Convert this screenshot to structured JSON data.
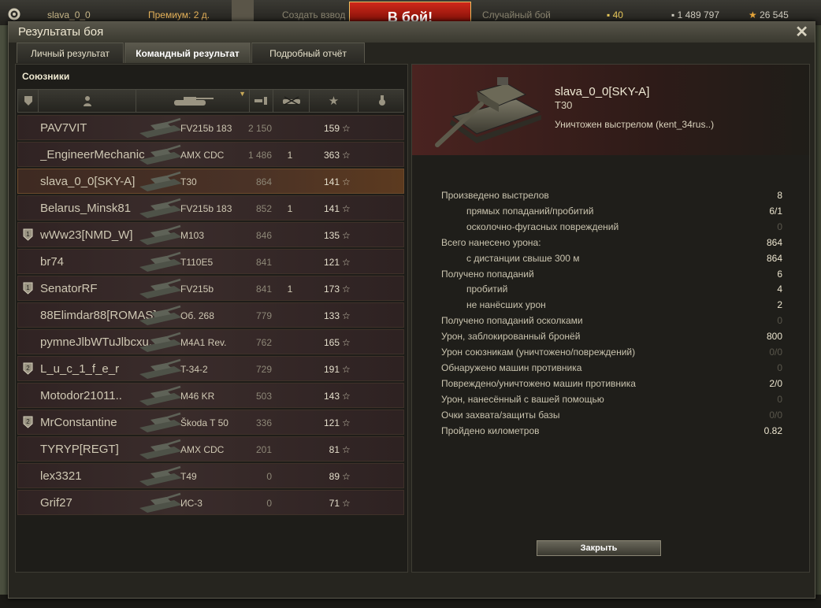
{
  "topbar": {
    "nick": "slava_0_0",
    "premium": "Премиум: 2 д.",
    "create_squad": "Создать взвод",
    "battle_button": "В бой!",
    "battle_mode": "Случайный бой",
    "gold": "40",
    "credits": "1 489 797",
    "free_xp": "26 545"
  },
  "window": {
    "title": "Результаты боя",
    "tabs": [
      "Личный результат",
      "Командный результат",
      "Подробный отчёт"
    ],
    "active_tab": 1
  },
  "team": {
    "heading": "Союзники",
    "rows": [
      {
        "platoon": "",
        "name": "PAV7VIT",
        "tank": "FV215b 183",
        "damage": "2 150",
        "kills": "",
        "xp": "159"
      },
      {
        "platoon": "",
        "name": "_EngineerMechanic_",
        "tank": "AMX CDC",
        "damage": "1 486",
        "kills": "1",
        "xp": "363"
      },
      {
        "platoon": "",
        "name": "slava_0_0[SKY-A]",
        "tank": "T30",
        "damage": "864",
        "kills": "",
        "xp": "141"
      },
      {
        "platoon": "",
        "name": "Belarus_Minsk81",
        "tank": "FV215b 183",
        "damage": "852",
        "kills": "1",
        "xp": "141"
      },
      {
        "platoon": "1",
        "name": "wWw23[NMD_W]",
        "tank": "M103",
        "damage": "846",
        "kills": "",
        "xp": "135"
      },
      {
        "platoon": "",
        "name": "br74",
        "tank": "T110E5",
        "damage": "841",
        "kills": "",
        "xp": "121"
      },
      {
        "platoon": "1",
        "name": "SenatorRF",
        "tank": "FV215b",
        "damage": "841",
        "kills": "1",
        "xp": "173"
      },
      {
        "platoon": "",
        "name": "88Elimdar88[ROMAS]",
        "tank": "Об. 268",
        "damage": "779",
        "kills": "",
        "xp": "133"
      },
      {
        "platoon": "",
        "name": "pymneJlbWTuJlbcxu..",
        "tank": "M4A1 Rev.",
        "damage": "762",
        "kills": "",
        "xp": "165"
      },
      {
        "platoon": "2",
        "name": "L_u_c_1_f_e_r",
        "tank": "T-34-2",
        "damage": "729",
        "kills": "",
        "xp": "191"
      },
      {
        "platoon": "",
        "name": "Motodor21011..",
        "tank": "M46 KR",
        "damage": "503",
        "kills": "",
        "xp": "143"
      },
      {
        "platoon": "2",
        "name": "MrConstantine",
        "tank": "Škoda T 50",
        "damage": "336",
        "kills": "",
        "xp": "121"
      },
      {
        "platoon": "",
        "name": "TYRYP[REGT]",
        "tank": "AMX CDC",
        "damage": "201",
        "kills": "",
        "xp": "81"
      },
      {
        "platoon": "",
        "name": "lex3321",
        "tank": "T49",
        "damage": "0",
        "kills": "",
        "xp": "89"
      },
      {
        "platoon": "",
        "name": "Grif27",
        "tank": "ИС-3",
        "damage": "0",
        "kills": "",
        "xp": "71"
      }
    ],
    "selected_row": 2
  },
  "player": {
    "name": "slava_0_0[SKY-A]",
    "vehicle": "T30",
    "status": "Уничтожен выстрелом (kent_34rus..)",
    "stats": [
      {
        "label": "Произведено выстрелов",
        "value": "8",
        "indent": false,
        "dim": false
      },
      {
        "label": "прямых попаданий/пробитий",
        "value": "6/1",
        "indent": true,
        "dim": false
      },
      {
        "label": "осколочно-фугасных повреждений",
        "value": "0",
        "indent": true,
        "dim": true
      },
      {
        "label": "Всего нанесено урона:",
        "value": "864",
        "indent": false,
        "dim": false
      },
      {
        "label": "с дистанции свыше 300 м",
        "value": "864",
        "indent": true,
        "dim": false
      },
      {
        "label": "Получено попаданий",
        "value": "6",
        "indent": false,
        "dim": false
      },
      {
        "label": "пробитий",
        "value": "4",
        "indent": true,
        "dim": false
      },
      {
        "label": "не нанёсших урон",
        "value": "2",
        "indent": true,
        "dim": false
      },
      {
        "label": "Получено попаданий осколками",
        "value": "0",
        "indent": false,
        "dim": true
      },
      {
        "label": "Урон, заблокированный бронёй",
        "value": "800",
        "indent": false,
        "dim": false
      },
      {
        "label": "Урон союзникам (уничтожено/повреждений)",
        "value": "0/0",
        "indent": false,
        "dim": true
      },
      {
        "label": "Обнаружено машин противника",
        "value": "0",
        "indent": false,
        "dim": true
      },
      {
        "label": "Повреждено/уничтожено машин противника",
        "value": "2/0",
        "indent": false,
        "dim": false
      },
      {
        "label": "Урон, нанесённый с вашей помощью",
        "value": "0",
        "indent": false,
        "dim": true
      },
      {
        "label": "Очки захвата/защиты базы",
        "value": "0/0",
        "indent": false,
        "dim": true
      },
      {
        "label": "Пройдено километров",
        "value": "0.82",
        "indent": false,
        "dim": false
      }
    ],
    "close_button": "Закрыть"
  },
  "icons": {
    "close": "close-icon",
    "star": "star-icon",
    "platoon": "platoon-icon"
  },
  "colors": {
    "row_bg": "#3a2c2b",
    "selected_row": "#5c3a1f",
    "battle_button": "#c0261a"
  }
}
